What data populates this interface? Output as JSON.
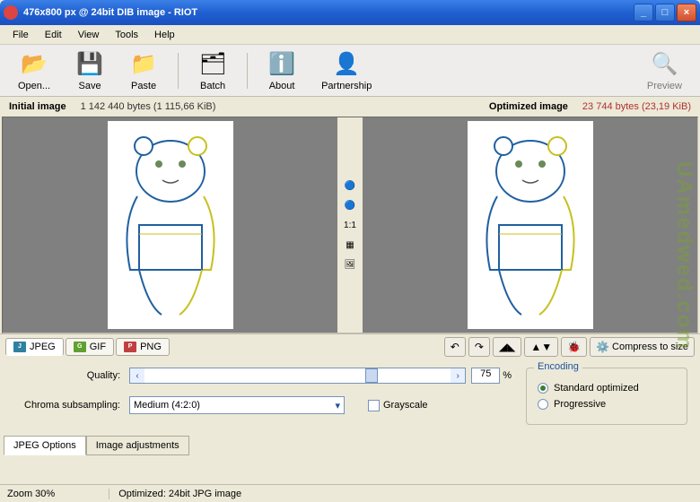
{
  "window": {
    "title": "476x800 px @ 24bit  DIB image - RIOT"
  },
  "menubar": [
    "File",
    "Edit",
    "View",
    "Tools",
    "Help"
  ],
  "toolbar": [
    {
      "label": "Open...",
      "icon": "📂"
    },
    {
      "label": "Save",
      "icon": "💾"
    },
    {
      "label": "Paste",
      "icon": "📁"
    },
    {
      "label": "Batch",
      "icon": "🗂"
    },
    {
      "label": "About",
      "icon": "ℹ️"
    },
    {
      "label": "Partnership",
      "icon": "👤"
    }
  ],
  "toolbar_right": {
    "label": "Preview",
    "icon": "🔍"
  },
  "info": {
    "initial_label": "Initial image",
    "initial_bytes": "1 142 440 bytes (1 115,66 KiB)",
    "optimized_label": "Optimized image",
    "optimized_bytes": "23 744 bytes (23,19 KiB)"
  },
  "center_tools": [
    "🔵",
    "🔵",
    "1:1",
    "▦",
    "🖼"
  ],
  "formats": [
    {
      "label": "JPEG",
      "cls": "jpeg",
      "active": true
    },
    {
      "label": "GIF",
      "cls": "gif",
      "active": false
    },
    {
      "label": "PNG",
      "cls": "png",
      "active": false
    }
  ],
  "actions": {
    "undo": "↶",
    "redo": "↷",
    "flip_h": "◢◣",
    "flip_v": "▲▼",
    "bug": "🐞",
    "compress_label": "Compress to size",
    "compress_icon": "⚙️"
  },
  "settings": {
    "quality_label": "Quality:",
    "quality_value": "75",
    "quality_pct": "%",
    "chroma_label": "Chroma subsampling:",
    "chroma_value": "Medium (4:2:0)",
    "grayscale_label": "Grayscale",
    "encoding_legend": "Encoding",
    "encoding_options": [
      "Standard optimized",
      "Progressive"
    ],
    "encoding_selected": 0
  },
  "bottom_tabs": [
    "JPEG Options",
    "Image adjustments"
  ],
  "statusbar": {
    "zoom": "Zoom 30%",
    "optimized": "Optimized: 24bit JPG image"
  },
  "watermark": "UAmedwed.com"
}
